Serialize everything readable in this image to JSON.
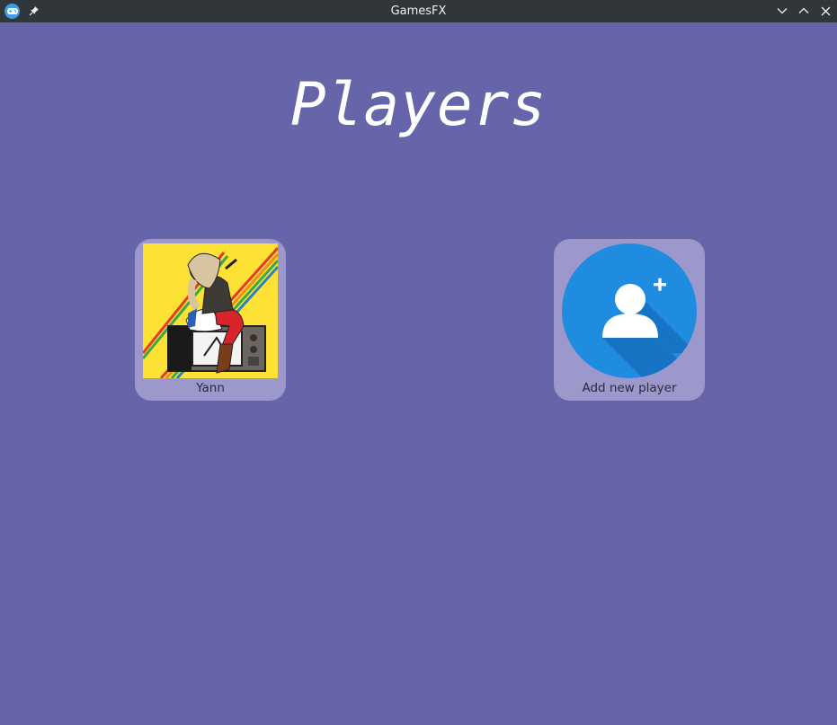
{
  "window": {
    "title": "GamesFX",
    "app_icon": "gamepad-icon",
    "pin_icon": "pin-icon",
    "controls": [
      "minimize-icon",
      "maximize-icon",
      "close-icon"
    ]
  },
  "page": {
    "title": "Players"
  },
  "players": [
    {
      "name": "Yann",
      "avatar": "character-on-tv-image"
    }
  ],
  "add_player": {
    "label": "Add new player",
    "icon": "add-user-icon"
  },
  "colors": {
    "background": "#6665aa",
    "card": "#9c98cc",
    "titlebar": "#31363b",
    "add_circle": "#1f8ce0",
    "avatar_bg": "#fde135"
  }
}
